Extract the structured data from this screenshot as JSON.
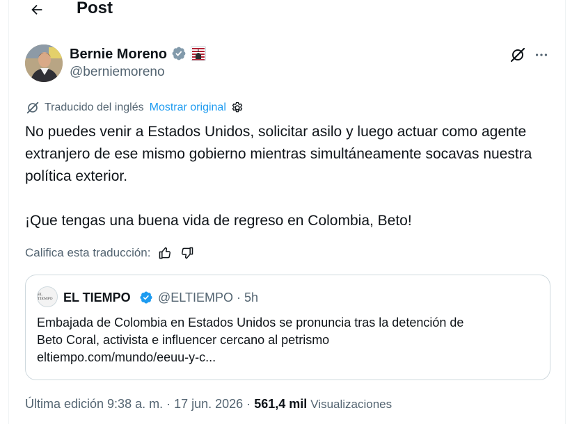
{
  "header": {
    "title": "Post",
    "back_icon": "arrow-left-icon"
  },
  "author": {
    "name": "Bernie Moreno",
    "handle": "@berniemoreno",
    "verified_color": "#1d9bf0",
    "affiliate_badge": "us-capitol-flag-icon"
  },
  "translation": {
    "label": "Traducido del inglés",
    "show_original": "Mostrar original",
    "link_color": "#1d9bf0"
  },
  "tweet": {
    "paragraph_1": "No puedes venir a Estados Unidos, solicitar asilo y luego actuar como agente extranjero de ese mismo gobierno mientras simultáneamente socavas nuestra política exterior.",
    "paragraph_2": "¡Que tengas una buena vida de regreso en Colombia, Beto!"
  },
  "rating": {
    "label": "Califica esta traducción:"
  },
  "quote": {
    "name": "EL TIEMPO",
    "handle": "@ELTIEMPO",
    "separator": "·",
    "time": "5h",
    "avatar_text": "EL TIEMPO",
    "text_line_1": "Embajada de Colombia en Estados Unidos se pronuncia tras la detención de",
    "text_line_2": "Beto Coral, activista e influencer cercano al petrismo",
    "link": "eltiempo.com/mundo/eeuu-y-c..."
  },
  "footer": {
    "edited": "Última edición 9:38 a. m. · 17 jun. 2026 ·",
    "views_count": "561,4 mil",
    "views_label": "Visualizaciones"
  },
  "colors": {
    "text": "#0f1419",
    "secondary": "#536471",
    "border": "#cfd9de",
    "accent": "#1d9bf0"
  }
}
